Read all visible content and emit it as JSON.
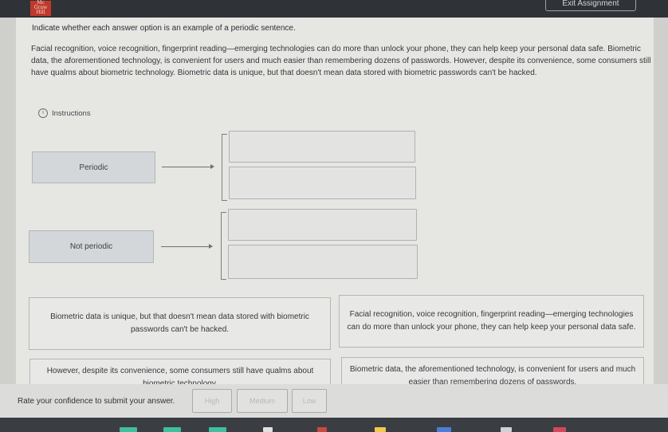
{
  "header": {
    "logo_text": "Mc Graw Hill",
    "exit_label": "Exit Assignment"
  },
  "question": {
    "prompt": "Indicate whether each answer option is an example of a periodic sentence.",
    "passage": "Facial recognition, voice recognition, fingerprint reading—emerging technologies can do more than unlock your phone, they can help keep your personal data safe. Biometric data, the aforementioned technology, is convenient for users and much easier than remembering dozens of passwords. However, despite its convenience, some consumers still have qualms about biometric technology. Biometric data is unique, but that doesn't mean data stored with biometric passwords can't be hacked.",
    "instructions_label": "Instructions"
  },
  "categories": [
    {
      "label": "Periodic"
    },
    {
      "label": "Not periodic"
    }
  ],
  "answer_cards": [
    {
      "text": "Biometric data is unique, but that doesn't mean data stored with biometric passwords can't be hacked."
    },
    {
      "text": "Facial recognition, voice recognition, fingerprint reading—emerging technologies can do more than unlock your phone, they can help keep your personal data safe."
    },
    {
      "text": "However, despite its convenience, some consumers still have qualms about biometric technology."
    },
    {
      "text": "Biometric data, the aforementioned technology, is convenient for users and much easier than remembering dozens of passwords."
    }
  ],
  "confidence": {
    "label": "Rate your confidence to submit your answer.",
    "options": [
      "High",
      "Medium",
      "Low"
    ]
  },
  "colors": {
    "brand": "#c0392b",
    "topbar": "#2f3338"
  }
}
